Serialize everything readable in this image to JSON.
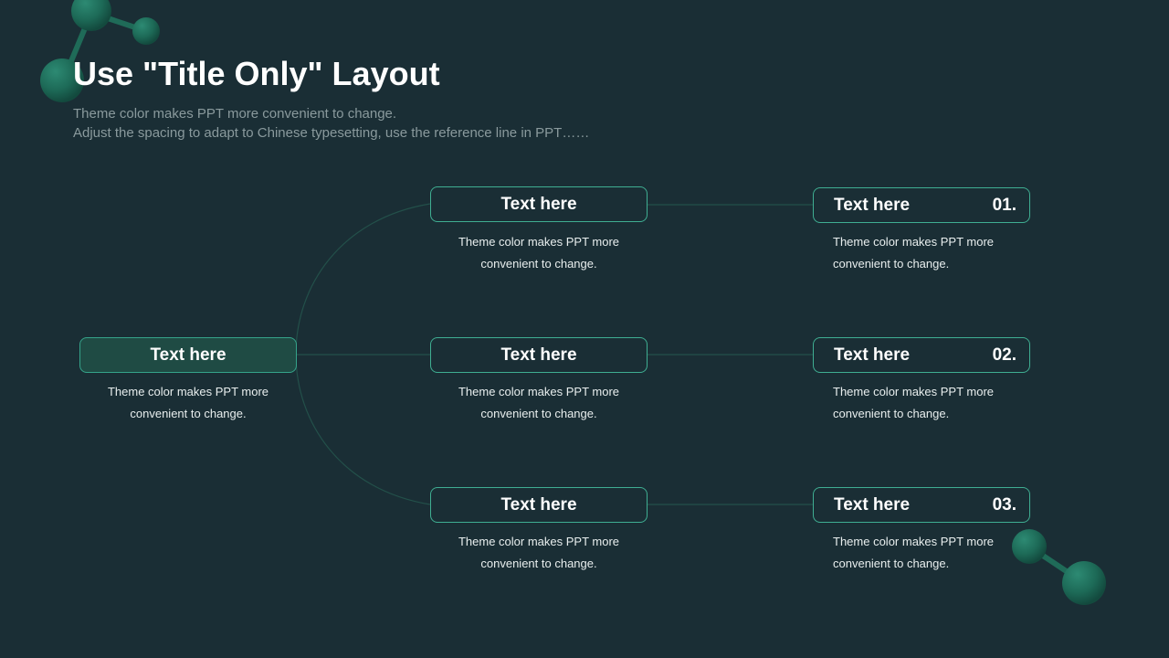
{
  "header": {
    "title": "Use \"Title Only\" Layout",
    "subtitle_line1": "Theme color makes PPT more convenient to change.",
    "subtitle_line2": "Adjust the spacing to adapt to Chinese typesetting, use the reference line in PPT……"
  },
  "root": {
    "label": "Text here",
    "desc_line1": "Theme color makes PPT more",
    "desc_line2": "convenient to change."
  },
  "middle": [
    {
      "label": "Text here",
      "desc_line1": "Theme color makes PPT more",
      "desc_line2": "convenient to change."
    },
    {
      "label": "Text here",
      "desc_line1": "Theme color makes PPT more",
      "desc_line2": "convenient to change."
    },
    {
      "label": "Text here",
      "desc_line1": "Theme color makes PPT more",
      "desc_line2": "convenient to change."
    }
  ],
  "right": [
    {
      "label": "Text here",
      "number": "01.",
      "desc_line1": "Theme color makes PPT more",
      "desc_line2": "convenient to change."
    },
    {
      "label": "Text here",
      "number": "02.",
      "desc_line1": "Theme color makes PPT more",
      "desc_line2": "convenient to change."
    },
    {
      "label": "Text here",
      "number": "03.",
      "desc_line1": "Theme color makes PPT more",
      "desc_line2": "convenient to change."
    }
  ],
  "colors": {
    "background": "#1a2e35",
    "accent": "#3fae92",
    "connector": "#2a5a54",
    "molecule": "#1f6b58"
  }
}
